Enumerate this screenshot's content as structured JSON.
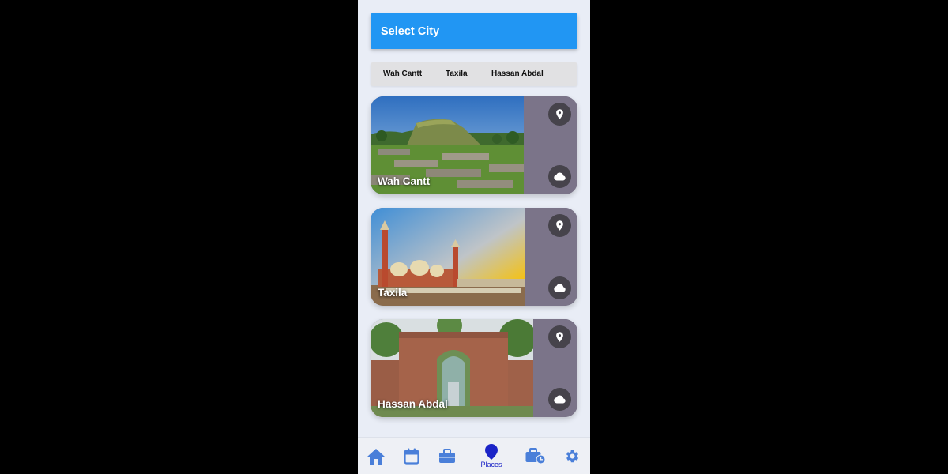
{
  "header": {
    "title": "Select City"
  },
  "city_tabs": [
    {
      "label": "Wah Cantt"
    },
    {
      "label": "Taxila"
    },
    {
      "label": "Hassan Abdal"
    }
  ],
  "cards": [
    {
      "label": "Wah Cantt",
      "location_icon": "location-pin-icon",
      "weather_icon": "cloud-icon"
    },
    {
      "label": "Taxila",
      "location_icon": "location-pin-icon",
      "weather_icon": "cloud-icon"
    },
    {
      "label": "Hassan Abdal",
      "location_icon": "location-pin-icon",
      "weather_icon": "cloud-icon"
    }
  ],
  "bottom_nav": {
    "items": [
      {
        "icon": "home-icon"
      },
      {
        "icon": "calendar-icon"
      },
      {
        "icon": "briefcase-icon"
      },
      {
        "icon": "map-pin-icon",
        "label": "Places",
        "active": true
      },
      {
        "icon": "briefcase-clock-icon"
      },
      {
        "icon": "gear-icon"
      }
    ]
  },
  "colors": {
    "primary": "#2196f3",
    "nav_icon": "#4a7fd9",
    "nav_active": "#1b24c7",
    "card_side": "#7b7489",
    "button_bg": "#46434b"
  }
}
